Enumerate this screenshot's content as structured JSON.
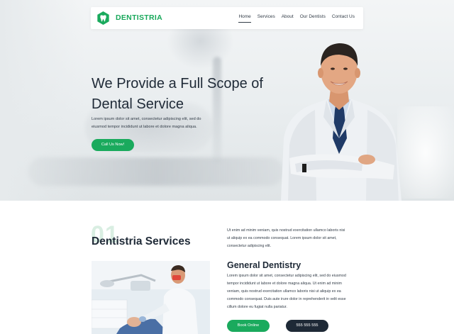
{
  "brand": {
    "name": "DENTISTRIA",
    "accent": "#1aaa5d"
  },
  "nav": {
    "items": [
      {
        "label": "Home",
        "active": true
      },
      {
        "label": "Services"
      },
      {
        "label": "About"
      },
      {
        "label": "Our Dentists"
      },
      {
        "label": "Contact Us"
      }
    ]
  },
  "hero": {
    "title_line1": "We Provide a Full Scope of",
    "title_line2": "Dental Service",
    "desc_line1": "Lorem ipsum dolor sit amet, consectetur adipiscing elit, sed do",
    "desc_line2": "eiusmod tempor incididunt ut labore et dolore magna aliqua.",
    "cta": "Call Us Now!"
  },
  "services": {
    "number": "01",
    "title": "Dentistria Services",
    "intro_lines": [
      "Ut enim ad minim veniam, quis nostrud exercitation ullamco laboris nisi",
      "ut aliquip ex ea commodo consequat. Lorem ipsum dolor sit amet,",
      "consectetur adipiscing elit."
    ],
    "general": {
      "title": "General Dentistry",
      "lines": [
        "Lorem ipsum dolor sit amet, consectetur adipiscing elit, sed do eiusmod",
        "tempor incididunt ut labore et dolore magna aliqua. Ut enim ad minim",
        "veniam, quis nostrud exercitation ullamco laboris nisi ut aliquip ex ea",
        "commodo consequat. Duis aute irure dolor in reprehenderit in velit esse",
        "cillum dolore eu fugiat nulla pariatur."
      ],
      "book_label": "Book Online",
      "phone_label": "555 555 555"
    }
  },
  "icons": {
    "logo": "tooth-hexagon-icon"
  }
}
